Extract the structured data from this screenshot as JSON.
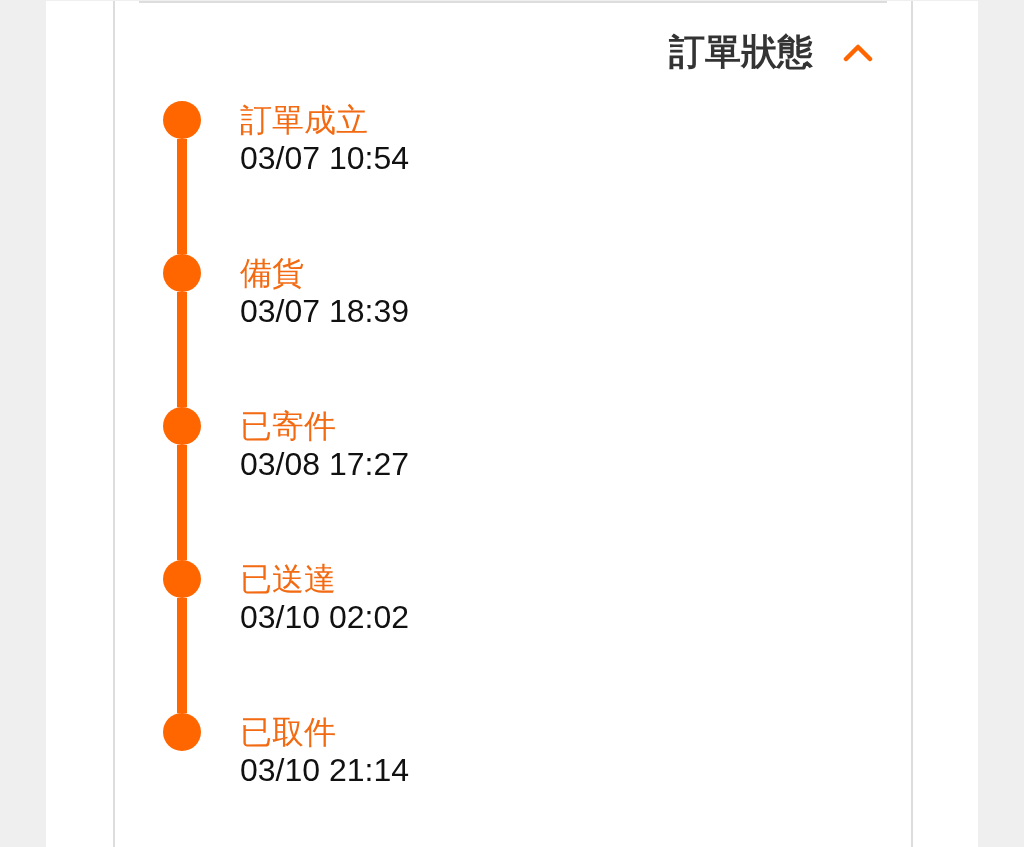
{
  "header": {
    "title": "訂單狀態",
    "expanded": true
  },
  "timeline": [
    {
      "label": "訂單成立",
      "time": "03/07 10:54"
    },
    {
      "label": "備貨",
      "time": "03/07 18:39"
    },
    {
      "label": "已寄件",
      "time": "03/08 17:27"
    },
    {
      "label": "已送達",
      "time": "03/10 02:02"
    },
    {
      "label": "已取件",
      "time": "03/10 21:14"
    }
  ]
}
